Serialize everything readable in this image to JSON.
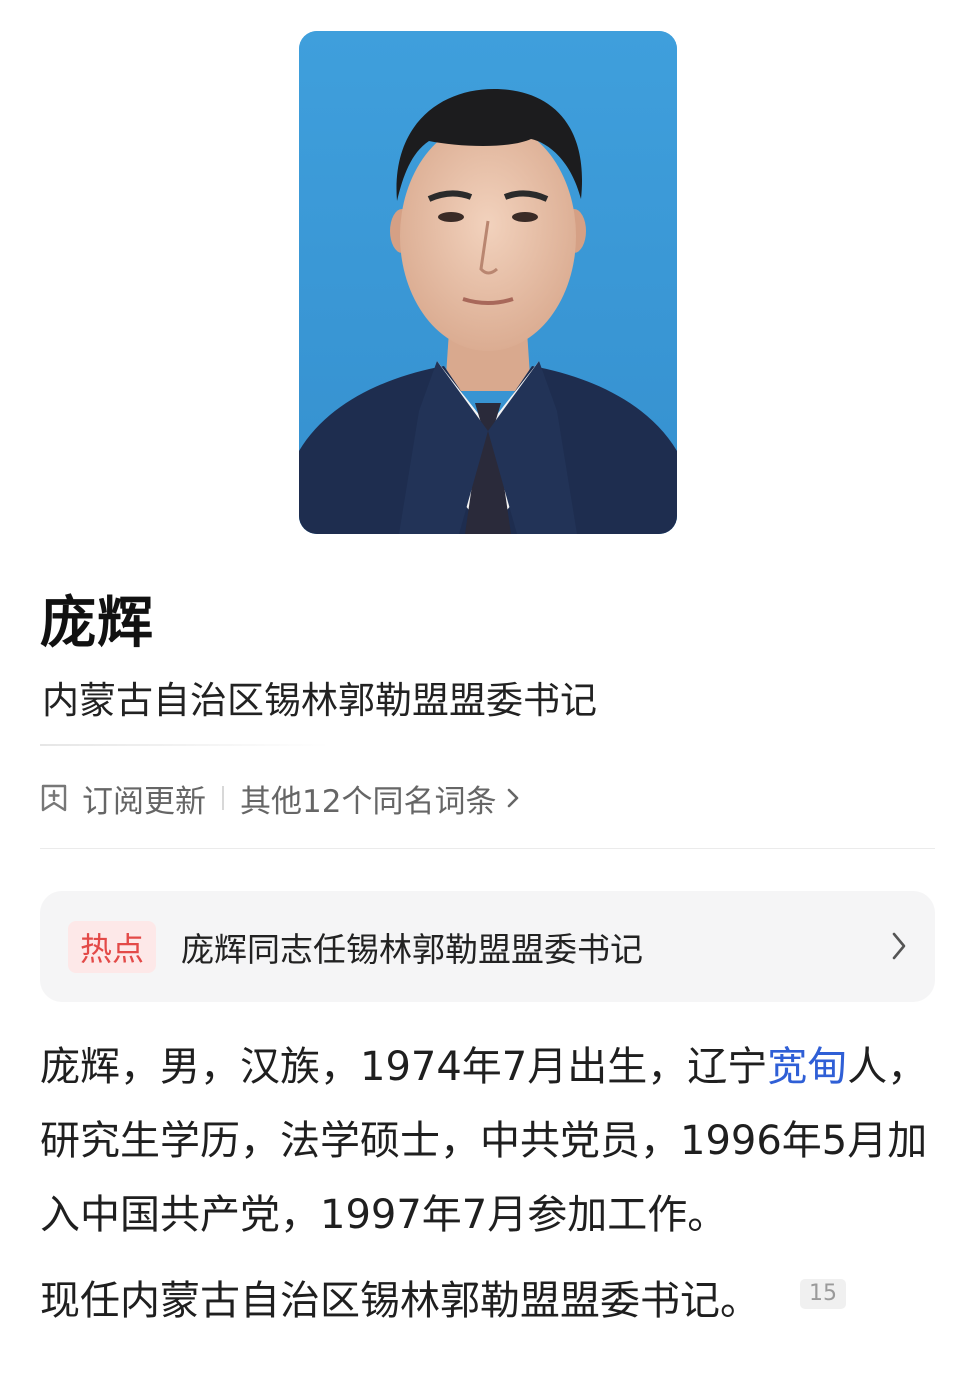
{
  "person": {
    "name": "庞辉",
    "title": "内蒙古自治区锡林郭勒盟盟委书记"
  },
  "actions": {
    "subscribe_label": "订阅更新",
    "same_name_label": "其他12个同名词条"
  },
  "hot": {
    "badge": "热点",
    "text": "庞辉同志任锡林郭勒盟盟委书记"
  },
  "bio": {
    "para1_a": "庞辉，男，汉族，1974年7月出生，辽宁",
    "para1_link": "宽甸",
    "para1_b": "人，研究生学历，法学硕士，中共党员，1996年5月加入中国共产党，1997年7月参加工作。",
    "para2": "现任内蒙古自治区锡林郭勒盟盟委书记。",
    "ref_number": "15"
  },
  "colors": {
    "accent_link": "#2f5fd6",
    "hot_badge_text": "#e34a48",
    "hot_badge_bg": "#fde8e8",
    "portrait_bg": "#3d9ad6"
  },
  "icons": {
    "subscribe": "subscribe-icon",
    "chevron": "chevron-right-icon"
  }
}
